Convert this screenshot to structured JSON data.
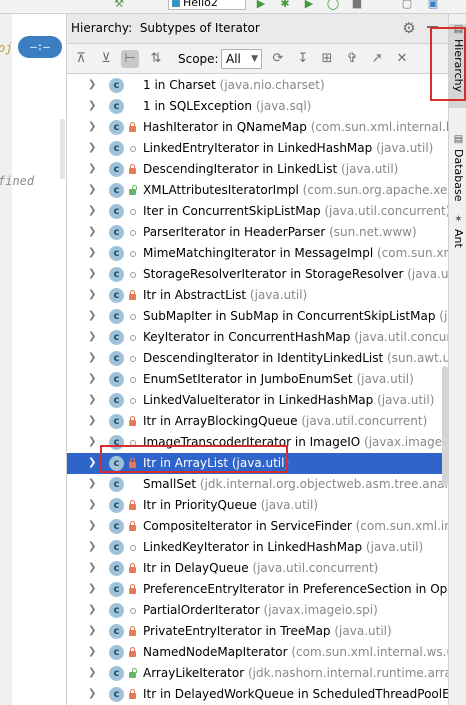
{
  "top_toolbar": {
    "run_config": "Hello2",
    "icons": [
      "build-hammer-icon",
      "run-icon",
      "debug-icon",
      "run-coverage-icon",
      "profile-icon",
      "stop-icon",
      "frame-icon"
    ]
  },
  "editor": {
    "badge": "—:—",
    "code_lines": [
      "oj",
      "fined"
    ]
  },
  "hierarchy": {
    "title": "Hierarchy:",
    "subtitle": "Subtypes of Iterator",
    "scope_label": "Scope:",
    "scope_value": "All",
    "rows": [
      {
        "name": "1 in Charset",
        "pkg": "(java.nio.charset)",
        "mod": "none",
        "selected": false
      },
      {
        "name": "1 in SQLException",
        "pkg": "(java.sql)",
        "mod": "none",
        "selected": false
      },
      {
        "name": "HashIterator in QNameMap",
        "pkg": "(com.sun.xml.internal.bin",
        "mod": "lock",
        "selected": false
      },
      {
        "name": "LinkedEntryIterator in LinkedHashMap",
        "pkg": "(java.util)",
        "mod": "pkg",
        "selected": false
      },
      {
        "name": "DescendingIterator in LinkedList",
        "pkg": "(java.util)",
        "mod": "lock",
        "selected": false
      },
      {
        "name": "XMLAttributesIteratorImpl",
        "pkg": "(com.sun.org.apache.xerc",
        "mod": "open",
        "selected": false
      },
      {
        "name": "Iter in ConcurrentSkipListMap",
        "pkg": "(java.util.concurrent)",
        "mod": "pkg",
        "selected": false
      },
      {
        "name": "ParserIterator in HeaderParser",
        "pkg": "(sun.net.www)",
        "mod": "pkg",
        "selected": false
      },
      {
        "name": "MimeMatchingIterator in MessageImpl",
        "pkg": "(com.sun.xm",
        "mod": "pkg",
        "selected": false
      },
      {
        "name": "StorageResolverIterator in StorageResolver",
        "pkg": "(java.util)",
        "mod": "pkg",
        "selected": false
      },
      {
        "name": "Itr in AbstractList",
        "pkg": "(java.util)",
        "mod": "lock",
        "selected": false
      },
      {
        "name": "SubMapIter in SubMap in ConcurrentSkipListMap",
        "pkg": "(java.u",
        "mod": "pkg",
        "selected": false
      },
      {
        "name": "KeyIterator in ConcurrentHashMap",
        "pkg": "(java.util.concurre",
        "mod": "pkg",
        "selected": false
      },
      {
        "name": "DescendingIterator in IdentityLinkedList",
        "pkg": "(sun.awt.util)",
        "mod": "pkg",
        "selected": false
      },
      {
        "name": "EnumSetIterator in JumboEnumSet",
        "pkg": "(java.util)",
        "mod": "pkg",
        "selected": false
      },
      {
        "name": "LinkedValueIterator in LinkedHashMap",
        "pkg": "(java.util)",
        "mod": "pkg",
        "selected": false
      },
      {
        "name": "Itr in ArrayBlockingQueue",
        "pkg": "(java.util.concurrent)",
        "mod": "lock",
        "selected": false
      },
      {
        "name": "ImageTranscoderIterator in ImageIO",
        "pkg": "(javax.imageio)",
        "mod": "pkg",
        "selected": false
      },
      {
        "name": "Itr in ArrayList",
        "pkg": "(java.util)",
        "mod": "lock",
        "selected": true
      },
      {
        "name": "SmallSet",
        "pkg": "(jdk.internal.org.objectweb.asm.tree.analysis",
        "mod": "none",
        "selected": false
      },
      {
        "name": "Itr in PriorityQueue",
        "pkg": "(java.util)",
        "mod": "lock",
        "selected": false
      },
      {
        "name": "CompositeIterator in ServiceFinder",
        "pkg": "(com.sun.xml.inte",
        "mod": "lock",
        "selected": false
      },
      {
        "name": "LinkedKeyIterator in LinkedHashMap",
        "pkg": "(java.util)",
        "mod": "pkg",
        "selected": false
      },
      {
        "name": "Itr in DelayQueue",
        "pkg": "(java.util.concurrent)",
        "mod": "lock",
        "selected": false
      },
      {
        "name": "PreferenceEntryIterator in PreferenceSection in Oper",
        "pkg": "",
        "mod": "lock",
        "selected": false
      },
      {
        "name": "PartialOrderIterator",
        "pkg": "(javax.imageio.spi)",
        "mod": "pkg",
        "selected": false
      },
      {
        "name": "PrivateEntryIterator in TreeMap",
        "pkg": "(java.util)",
        "mod": "lock",
        "selected": false
      },
      {
        "name": "NamedNodeMapIterator",
        "pkg": "(com.sun.xml.internal.ws.util.xm",
        "mod": "lock",
        "selected": false
      },
      {
        "name": "ArrayLikeIterator",
        "pkg": "(jdk.nashorn.internal.runtime.arrays",
        "mod": "open",
        "selected": false
      },
      {
        "name": "Itr in DelayedWorkQueue in ScheduledThreadPoolEx",
        "pkg": "",
        "mod": "lock",
        "selected": false
      }
    ]
  },
  "stripe": {
    "tabs": [
      {
        "label": "Hierarchy",
        "icon": "hierarchy-icon",
        "active": true
      },
      {
        "label": "Database",
        "icon": "database-icon",
        "active": false
      },
      {
        "label": "Ant",
        "icon": "ant-icon",
        "active": false
      }
    ]
  },
  "colors": {
    "selection": "#2f65ca",
    "highlight_box": "#d62e2e",
    "class_icon": "#9fc2d9",
    "package_text": "#888888"
  }
}
